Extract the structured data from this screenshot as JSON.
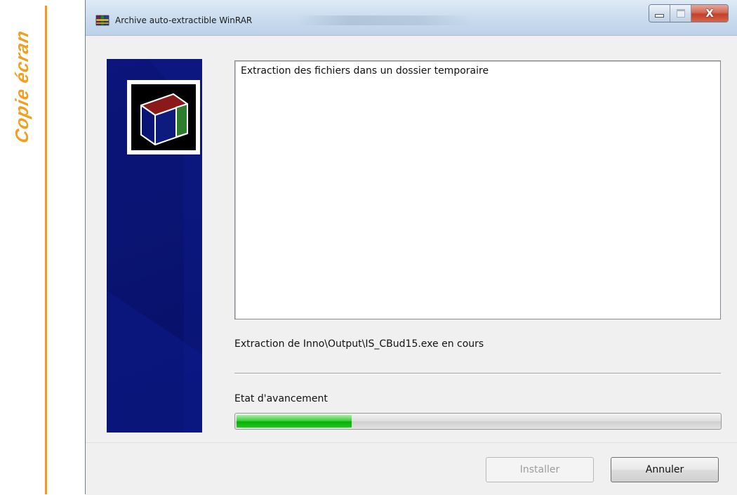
{
  "caption": {
    "text": "Copie écran",
    "color": "#f0a020"
  },
  "window": {
    "title": "Archive auto-extractible WinRAR",
    "icon": "winrar-archive-icon",
    "controls": {
      "minimize": "minimize-icon",
      "maximize": "maximize-icon",
      "close": "close-icon"
    }
  },
  "banner": {
    "logo": "archive-box-icon",
    "color": "#0b157a"
  },
  "main": {
    "panel_text": "Extraction des fichiers dans un dossier temporaire",
    "status_text": "Extraction de Inno\\Output\\IS_CBud15.exe en cours",
    "progress_label": "Etat d'avancement",
    "progress_fraction": 0.24,
    "progress_color": "#06b006"
  },
  "footer": {
    "install_label": "Installer",
    "install_enabled": false,
    "cancel_label": "Annuler"
  }
}
